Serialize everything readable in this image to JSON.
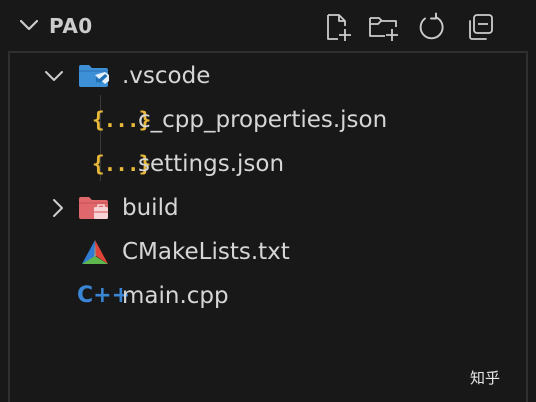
{
  "explorer": {
    "section_title": "PA0",
    "actions": [
      {
        "name": "new-file-icon",
        "label": "New File"
      },
      {
        "name": "new-folder-icon",
        "label": "New Folder"
      },
      {
        "name": "refresh-icon",
        "label": "Refresh Explorer"
      },
      {
        "name": "collapse-all-icon",
        "label": "Collapse Folders in Explorer"
      }
    ],
    "tree": [
      {
        "label": ".vscode",
        "type": "folder",
        "expanded": true,
        "icon": "vscode-folder-icon"
      },
      {
        "label": "c_cpp_properties.json",
        "type": "file",
        "icon": "json-icon",
        "icon_text": "{...}"
      },
      {
        "label": "settings.json",
        "type": "file",
        "icon": "json-icon",
        "icon_text": "{...}"
      },
      {
        "label": "build",
        "type": "folder",
        "expanded": false,
        "icon": "build-folder-icon"
      },
      {
        "label": "CMakeLists.txt",
        "type": "file",
        "icon": "cmake-icon"
      },
      {
        "label": "main.cpp",
        "type": "file",
        "icon": "cpp-icon",
        "icon_text": "C++"
      }
    ]
  },
  "colors": {
    "background": "#181818",
    "text": "#d6d6d6",
    "json_icon": "#e8b83a",
    "cpp_icon": "#3a86d4",
    "folder_vscode": "#3d8fd6",
    "folder_build": "#e0686d"
  },
  "watermark": {
    "text": "知乎"
  }
}
